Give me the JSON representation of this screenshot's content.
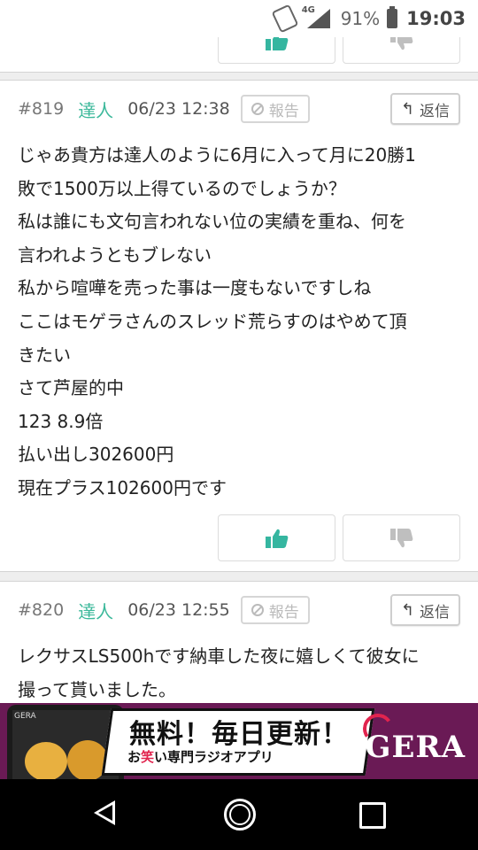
{
  "status_bar": {
    "network": "4G",
    "battery_percent": "91%",
    "time": "19:03"
  },
  "posts": [
    {
      "number": "#819",
      "author": "達人",
      "date": "06/23 12:38",
      "report_label": "報告",
      "reply_label": "返信",
      "body_lines": [
        "じゃあ貴方は達人のように6月に入って月に20勝1",
        "敗で1500万以上得ているのでしょうか？",
        "私は誰にも文句言われない位の実績を重ね、何を",
        "言われようともブレない",
        "私から喧嘩を売った事は一度もないですしね",
        "ここはモゲラさんのスレッド荒らすのはやめて頂",
        "きたい",
        "さて芦屋的中",
        "123 8.9倍",
        "払い出し302600円",
        "現在プラス102600円です"
      ]
    },
    {
      "number": "#820",
      "author": "達人",
      "date": "06/23 12:55",
      "report_label": "報告",
      "reply_label": "返信",
      "body_lines": [
        "レクサスLS500hです納車した夜に嬉しくて彼女に",
        "撮って貰いました。"
      ]
    }
  ],
  "ad": {
    "title": "無料！毎日更新！",
    "subtitle_prefix": "お",
    "subtitle_highlight": "笑",
    "subtitle_suffix": "い専門ラジオアプリ",
    "brand": "GERA",
    "phone_label": "GERA"
  },
  "colors": {
    "author": "#3bb89a",
    "like": "#35b6a0",
    "dislike": "#bfbfbf",
    "ad_bg": "#6a1a55",
    "ad_accent": "#e1244e"
  }
}
